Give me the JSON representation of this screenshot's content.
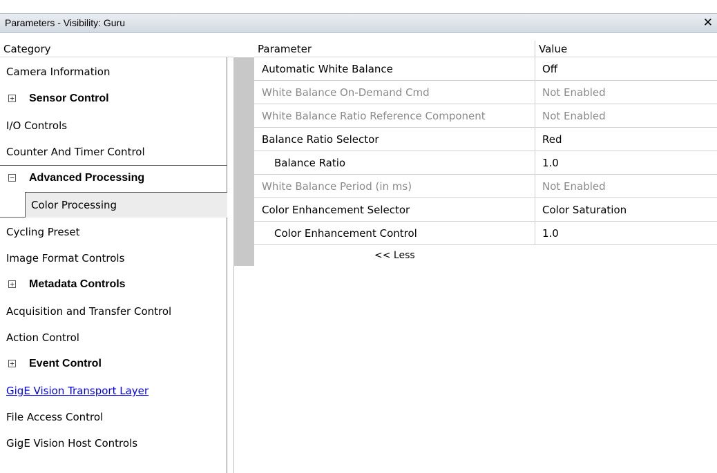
{
  "window": {
    "title": "Parameters - Visibility: Guru",
    "close_glyph": "✕"
  },
  "headers": {
    "category": "Category",
    "parameter": "Parameter",
    "value": "Value"
  },
  "categories": [
    {
      "label": "Camera Information",
      "expander": "",
      "bold": false
    },
    {
      "label": "Sensor Control",
      "expander": "⊞",
      "bold": true
    },
    {
      "label": "I/O Controls",
      "expander": "",
      "bold": false
    },
    {
      "label": "Counter And Timer Control",
      "expander": "",
      "bold": false
    },
    {
      "label": "Advanced Processing",
      "expander": "⊟",
      "bold": true
    },
    {
      "label": "Color Processing",
      "expander": "",
      "bold": false,
      "selected": true
    },
    {
      "label": "Cycling Preset",
      "expander": "",
      "bold": false
    },
    {
      "label": "Image Format Controls",
      "expander": "",
      "bold": false
    },
    {
      "label": "Metadata Controls",
      "expander": "⊞",
      "bold": true
    },
    {
      "label": "Acquisition and Transfer Control",
      "expander": "",
      "bold": false
    },
    {
      "label": "Action Control",
      "expander": "",
      "bold": false
    },
    {
      "label": "Event Control",
      "expander": "⊞",
      "bold": true
    },
    {
      "label": "GigE Vision Transport Layer",
      "expander": "",
      "bold": false,
      "link": true
    },
    {
      "label": "File Access Control",
      "expander": "",
      "bold": false
    },
    {
      "label": "GigE Vision Host Controls",
      "expander": "",
      "bold": false
    }
  ],
  "parameters": [
    {
      "name": "Automatic White Balance",
      "value": "Off",
      "enabled": true
    },
    {
      "name": "White Balance On-Demand Cmd",
      "value": "Not Enabled",
      "enabled": false
    },
    {
      "name": "White Balance Ratio Reference Component",
      "value": "Not Enabled",
      "enabled": false
    },
    {
      "name": "Balance Ratio Selector",
      "value": "Red",
      "enabled": true
    },
    {
      "name": "Balance Ratio",
      "value": "1.0",
      "enabled": true
    },
    {
      "name": "White Balance Period (in ms)",
      "value": "Not Enabled",
      "enabled": false
    },
    {
      "name": "Color Enhancement Selector",
      "value": "Color Saturation",
      "enabled": true
    },
    {
      "name": "Color Enhancement Control",
      "value": "1.0",
      "enabled": true
    }
  ],
  "less_label": "<< Less",
  "colors": {
    "link": "#0000ee",
    "disabled_text": "#8a8a8a",
    "gutter": "#c8c8c8",
    "selected_bg": "#ececec"
  }
}
